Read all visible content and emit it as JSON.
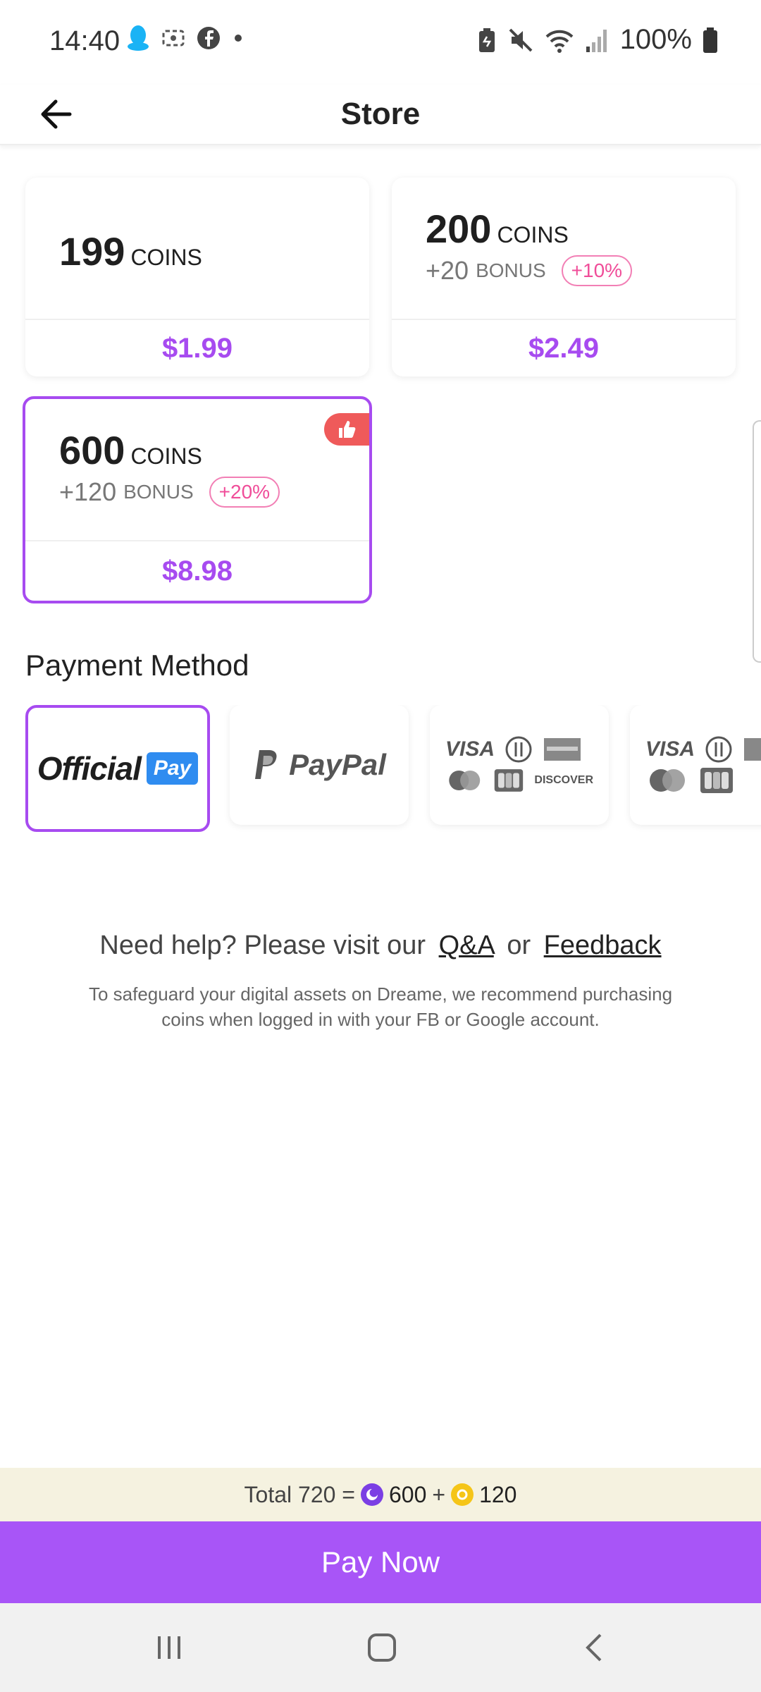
{
  "status_bar": {
    "time": "14:40",
    "battery": "100%",
    "left_icons": [
      "qq-icon",
      "screen-record-icon",
      "facebook-icon",
      "dot-icon"
    ],
    "right_icons": [
      "battery-saver-icon",
      "mute-icon",
      "wifi-icon",
      "signal-icon",
      "battery-icon"
    ]
  },
  "app_bar": {
    "title": "Store"
  },
  "packages": [
    {
      "coins": "199",
      "coins_unit": "COINS",
      "bonus": "",
      "bonus_unit": "",
      "bonus_pct": "",
      "price": "$1.99"
    },
    {
      "coins": "200",
      "coins_unit": "COINS",
      "bonus": "+20",
      "bonus_unit": "BONUS",
      "bonus_pct": "+10%",
      "price": "$2.49"
    },
    {
      "coins": "600",
      "coins_unit": "COINS",
      "bonus": "+120",
      "bonus_unit": "BONUS",
      "bonus_pct": "+20%",
      "price": "$8.98",
      "selected": true,
      "recommended": true
    }
  ],
  "payment": {
    "title": "Payment Method",
    "methods": [
      {
        "id": "official-pay",
        "label": "Official",
        "badge": "Pay",
        "selected": true
      },
      {
        "id": "paypal",
        "label": "PayPal"
      },
      {
        "id": "cards-1",
        "visa": "VISA",
        "discover": "DISCOVER"
      },
      {
        "id": "cards-2",
        "visa": "VISA"
      }
    ]
  },
  "help": {
    "prefix": "Need help? Please visit our",
    "qa": "Q&A",
    "or": "or",
    "feedback": "Feedback",
    "note": "To safeguard your digital assets on Dreame, we recommend purchasing coins when logged in with your FB or Google account."
  },
  "total": {
    "label": "Total 720 =",
    "coins": "600",
    "plus": "+",
    "bonus": "120"
  },
  "pay_button": "Pay Now",
  "colors": {
    "accent": "#a855f7",
    "price": "#a74bf0",
    "bonus_tag": "#f04d99",
    "badge": "#ef5a5a"
  }
}
